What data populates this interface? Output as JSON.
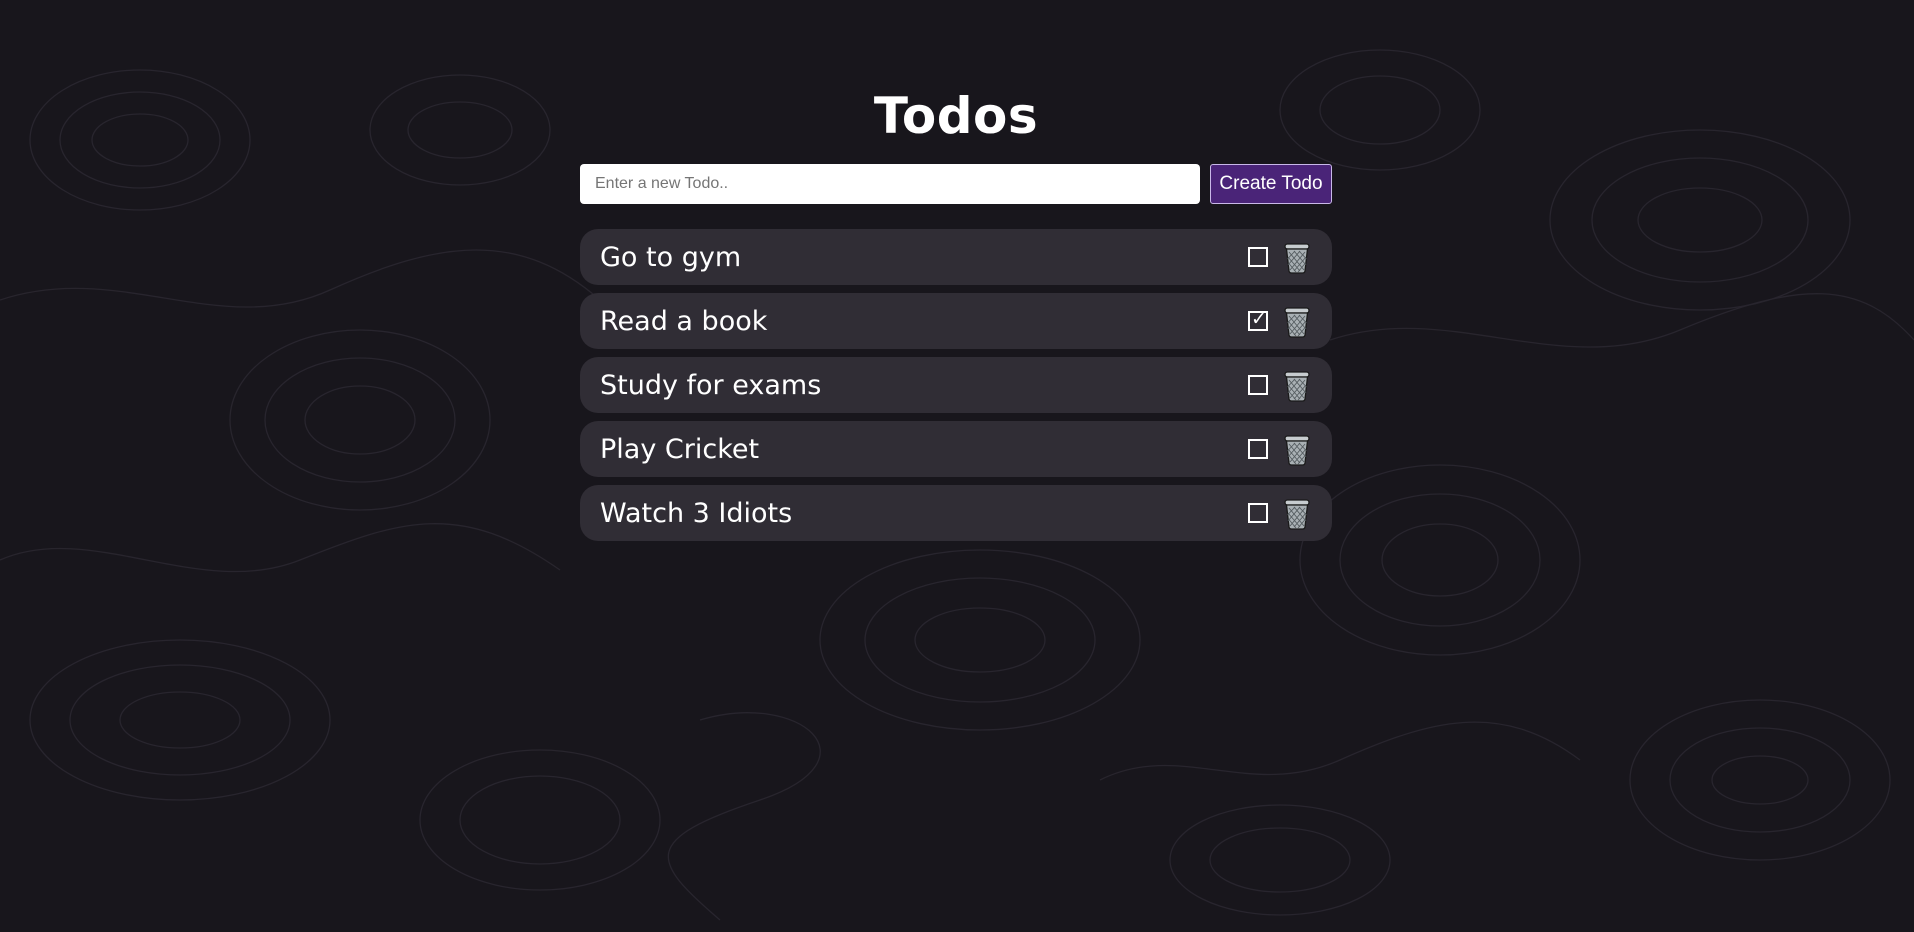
{
  "header": {
    "title": "Todos"
  },
  "create": {
    "placeholder": "Enter a new Todo..",
    "value": "",
    "button_label": "Create Todo"
  },
  "todos": [
    {
      "text": "Go to gym",
      "done": false
    },
    {
      "text": "Read a book",
      "done": true
    },
    {
      "text": "Study for exams",
      "done": false
    },
    {
      "text": "Play Cricket",
      "done": false
    },
    {
      "text": "Watch 3 Idiots",
      "done": false
    }
  ],
  "icons": {
    "delete": "trash-icon",
    "checked_glyph": "✓"
  },
  "colors": {
    "background": "#18161c",
    "item_background": "#302d35",
    "button_background": "#4a2478",
    "text": "#ffffff"
  }
}
